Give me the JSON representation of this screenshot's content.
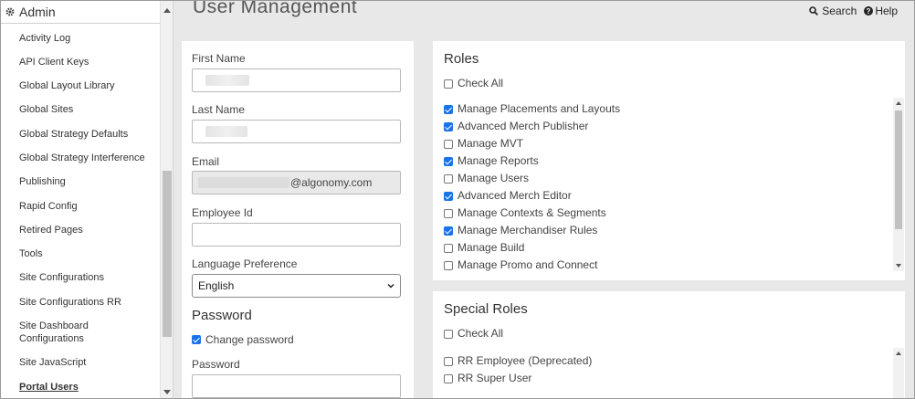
{
  "sidebar": {
    "header": "Admin",
    "items": [
      {
        "label": "Activity Log"
      },
      {
        "label": "API Client Keys"
      },
      {
        "label": "Global Layout Library"
      },
      {
        "label": "Global Sites"
      },
      {
        "label": "Global Strategy Defaults"
      },
      {
        "label": "Global Strategy Interference"
      },
      {
        "label": "Publishing"
      },
      {
        "label": "Rapid Config"
      },
      {
        "label": "Retired Pages"
      },
      {
        "label": "Tools"
      },
      {
        "label": "Site Configurations"
      },
      {
        "label": "Site Configurations RR"
      },
      {
        "label": "Site Dashboard Configurations"
      },
      {
        "label": "Site JavaScript"
      },
      {
        "label": "Portal Users"
      }
    ],
    "active_item": "Portal Users"
  },
  "header": {
    "title": "User Management",
    "search_label": "Search",
    "help_label": "Help"
  },
  "form": {
    "first_name_label": "First Name",
    "last_name_label": "Last Name",
    "email_label": "Email",
    "email_suffix": "@algonomy.com",
    "employee_id_label": "Employee Id",
    "employee_id_value": "",
    "language_label": "Language Preference",
    "language_value": "English",
    "password_section": "Password",
    "change_password_label": "Change password",
    "change_password_checked": true,
    "password_label": "Password"
  },
  "roles": {
    "title": "Roles",
    "check_all_label": "Check All",
    "items": [
      {
        "label": "Manage Placements and Layouts",
        "checked": true
      },
      {
        "label": "Advanced Merch Publisher",
        "checked": true
      },
      {
        "label": "Manage MVT",
        "checked": false
      },
      {
        "label": "Manage Reports",
        "checked": true
      },
      {
        "label": "Manage Users",
        "checked": false
      },
      {
        "label": "Advanced Merch Editor",
        "checked": true
      },
      {
        "label": "Manage Contexts & Segments",
        "checked": false
      },
      {
        "label": "Manage Merchandiser Rules",
        "checked": true
      },
      {
        "label": "Manage Build",
        "checked": false
      },
      {
        "label": "Manage Promo and Connect",
        "checked": false
      }
    ]
  },
  "special_roles": {
    "title": "Special Roles",
    "check_all_label": "Check All",
    "items": [
      {
        "label": "RR Employee (Deprecated)",
        "checked": false
      },
      {
        "label": "RR Super User",
        "checked": false
      }
    ]
  },
  "colors": {
    "checkbox_accent": "#1a73e8",
    "page_background": "#e8e8e8"
  }
}
